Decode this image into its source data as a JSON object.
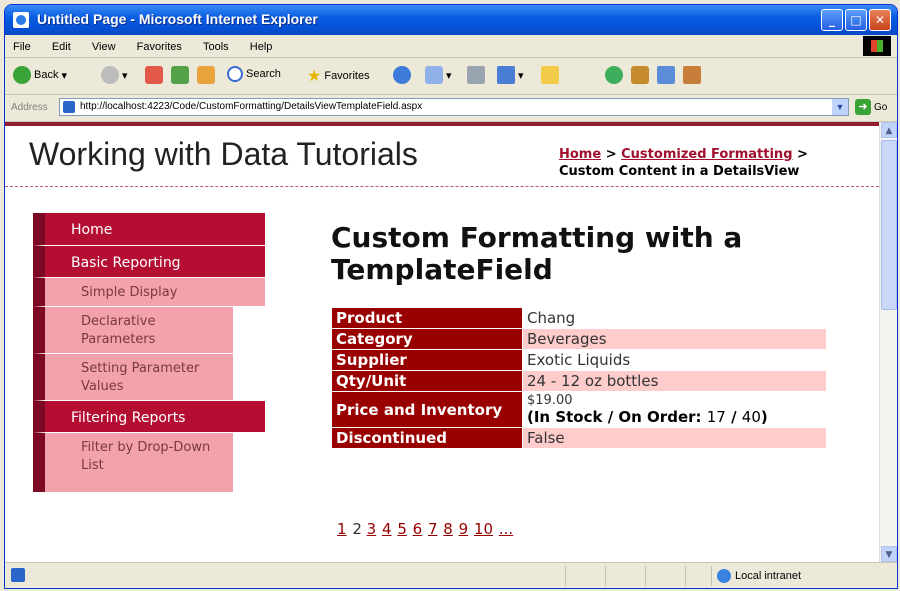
{
  "window": {
    "title": "Untitled Page - Microsoft Internet Explorer"
  },
  "menu": [
    "File",
    "Edit",
    "View",
    "Favorites",
    "Tools",
    "Help"
  ],
  "toolbar": {
    "back": "Back",
    "search": "Search",
    "favorites": "Favorites"
  },
  "address": {
    "label": "Address",
    "url": "http://localhost:4223/Code/CustomFormatting/DetailsViewTemplateField.aspx",
    "go": "Go"
  },
  "page": {
    "site_title": "Working with Data Tutorials",
    "breadcrumb": {
      "home": "Home",
      "sep1": " > ",
      "section": "Customized Formatting",
      "sep2": " >",
      "current": "Custom Content in a DetailsView"
    },
    "heading": "Custom Formatting with a TemplateField",
    "sidebar": [
      {
        "label": "Home",
        "level": 1
      },
      {
        "label": "Basic Reporting",
        "level": 1
      },
      {
        "label": "Simple Display",
        "level": 2
      },
      {
        "label": "Declarative Parameters",
        "level": 2
      },
      {
        "label": "Setting Parameter Values",
        "level": 2
      },
      {
        "label": "Filtering Reports",
        "level": 1
      },
      {
        "label": "Filter by Drop-Down List",
        "level": 2
      }
    ],
    "details": {
      "product_label": "Product",
      "product": "Chang",
      "category_label": "Category",
      "category": "Beverages",
      "supplier_label": "Supplier",
      "supplier": "Exotic Liquids",
      "qty_label": "Qty/Unit",
      "qty": "24 - 12 oz bottles",
      "price_label": "Price and Inventory",
      "price": "$19.00",
      "stock_open": "(In Stock / On Order: ",
      "in_stock": "17",
      "stock_sep": " / ",
      "on_order": "40",
      "stock_close": ")",
      "discontinued_label": "Discontinued",
      "discontinued": "False"
    },
    "pager": {
      "current": "2",
      "pages": [
        "1",
        "3",
        "4",
        "5",
        "6",
        "7",
        "8",
        "9",
        "10",
        "..."
      ]
    }
  },
  "status": {
    "zone": "Local intranet"
  }
}
